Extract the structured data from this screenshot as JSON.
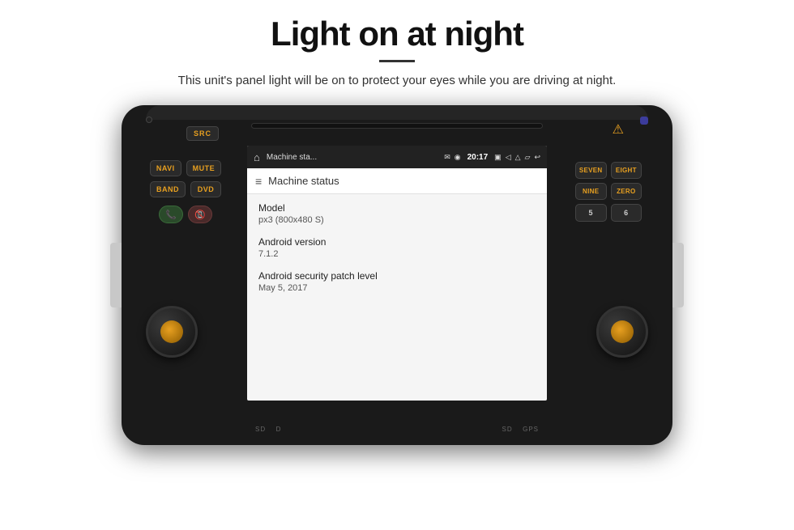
{
  "page": {
    "title": "Light on at night",
    "subtitle": "This unit's panel light will be on to protect your eyes while you are driving at night."
  },
  "unit": {
    "cd_slot": true,
    "left_buttons": [
      {
        "label": "NAVI",
        "row": 0
      },
      {
        "label": "MUTE",
        "row": 0
      },
      {
        "label": "BAND",
        "row": 1
      },
      {
        "label": "DVD",
        "row": 1
      }
    ],
    "src_label": "SRC",
    "right_buttons": [
      {
        "label": "SEVEN",
        "number": false
      },
      {
        "label": "EIGHT",
        "number": false
      },
      {
        "label": "NINE",
        "number": false
      },
      {
        "label": "ZERO",
        "number": false
      },
      {
        "label": "5",
        "number": true
      },
      {
        "label": "6",
        "number": true
      }
    ],
    "sd_label_left": "SD",
    "sd_label_right_1": "D",
    "sd_label_right_2": "GPS",
    "bottom_labels": [
      "SD",
      "D",
      "GPS"
    ]
  },
  "android": {
    "status_bar": {
      "app_name": "Machine sta...",
      "time": "20:17",
      "icons": [
        "msg",
        "pin",
        "camera",
        "vol",
        "media",
        "cast",
        "back"
      ]
    },
    "app_bar": {
      "title": "Machine status"
    },
    "info_items": [
      {
        "label": "Model",
        "value": "px3 (800x480 S)"
      },
      {
        "label": "Android version",
        "value": "7.1.2"
      },
      {
        "label": "Android security patch level",
        "value": "May 5, 2017"
      }
    ]
  }
}
